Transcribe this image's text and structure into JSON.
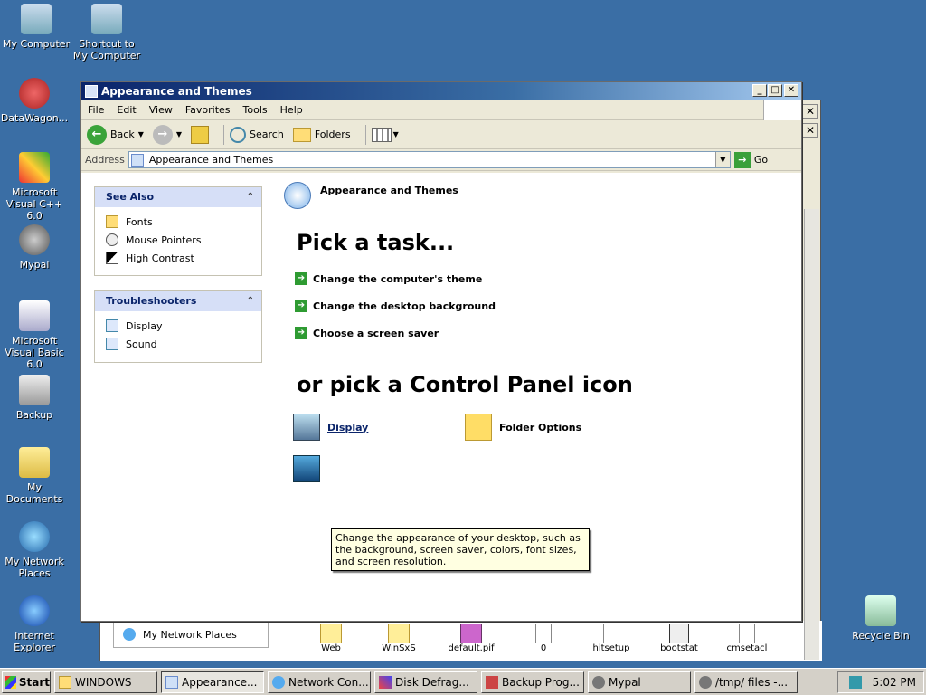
{
  "desktop": {
    "icons": [
      {
        "label": "My Computer"
      },
      {
        "label": "Shortcut to My Computer"
      },
      {
        "label": "DataWagon..."
      },
      {
        "label": "Microsoft Visual C++ 6.0"
      },
      {
        "label": "Mypal"
      },
      {
        "label": "Microsoft Visual Basic 6.0"
      },
      {
        "label": "Backup"
      },
      {
        "label": "My Documents"
      },
      {
        "label": "My Network Places"
      },
      {
        "label": "Internet Explorer"
      },
      {
        "label": "Recycle Bin"
      }
    ]
  },
  "back_window": {
    "network_places_label": "My Network Places",
    "files": [
      "Web",
      "WinSxS",
      "default.pif",
      "0",
      "hitsetup",
      "bootstat",
      "cmsetacl"
    ]
  },
  "window": {
    "title": "Appearance and Themes",
    "menu": [
      "File",
      "Edit",
      "View",
      "Favorites",
      "Tools",
      "Help"
    ],
    "toolbar": {
      "back": "Back",
      "search": "Search",
      "folders": "Folders"
    },
    "address": {
      "label": "Address",
      "value": "Appearance and Themes",
      "go": "Go"
    },
    "see_also": {
      "title": "See Also",
      "items": [
        "Fonts",
        "Mouse Pointers",
        "High Contrast"
      ]
    },
    "troubleshooters": {
      "title": "Troubleshooters",
      "items": [
        "Display",
        "Sound"
      ]
    },
    "category_title": "Appearance and Themes",
    "pick_task": "Pick a task...",
    "tasks": [
      "Change the computer's theme",
      "Change the desktop background",
      "Choose a screen saver"
    ],
    "or_pick": "or pick a Control Panel icon",
    "icons": {
      "display": "Display",
      "folder_options": "Folder Options"
    },
    "tooltip": "Change the appearance of your desktop, such as the background, screen saver, colors, font sizes, and screen resolution."
  },
  "taskbar": {
    "start": "Start",
    "buttons": [
      "WINDOWS",
      "Appearance...",
      "Network Con...",
      "Disk Defrag...",
      "Backup Prog...",
      "Mypal",
      "/tmp/ files -..."
    ],
    "clock": "5:02 PM"
  },
  "colors": {
    "desktop": "#3a6ea5",
    "title_gradient_start": "#0a246a",
    "panel_head": "#d6dff7"
  }
}
